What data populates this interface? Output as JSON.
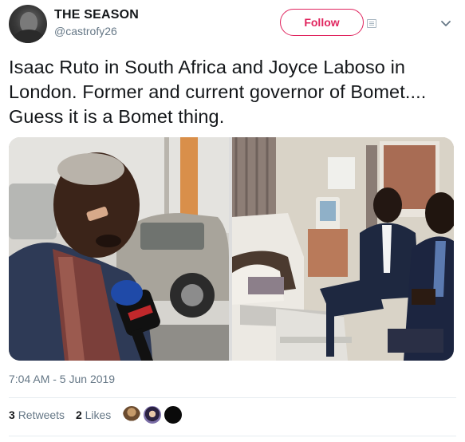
{
  "user": {
    "display_name": "THE SEASON",
    "handle": "@castrofy26",
    "avatar_icon": "profile-avatar"
  },
  "header": {
    "follow_label": "Follow",
    "follow_color": "#e0245e",
    "more_icon": "chevron-down-icon"
  },
  "tweet": {
    "text": "Isaac Ruto in South Africa and Joyce Laboso in London. Former and current governor of Bomet.... Guess it is a Bomet thing."
  },
  "media": {
    "images": [
      {
        "name": "photo-man-with-microphone"
      },
      {
        "name": "photo-hospital-room-visit"
      }
    ]
  },
  "meta": {
    "timestamp": "7:04 AM - 5 Jun 2019"
  },
  "stats": {
    "retweets_count": "3",
    "retweets_label": "Retweets",
    "likes_count": "2",
    "likes_label": "Likes"
  },
  "colors": {
    "text": "#14171a",
    "secondary": "#657786",
    "divider": "#e6ecf0"
  }
}
